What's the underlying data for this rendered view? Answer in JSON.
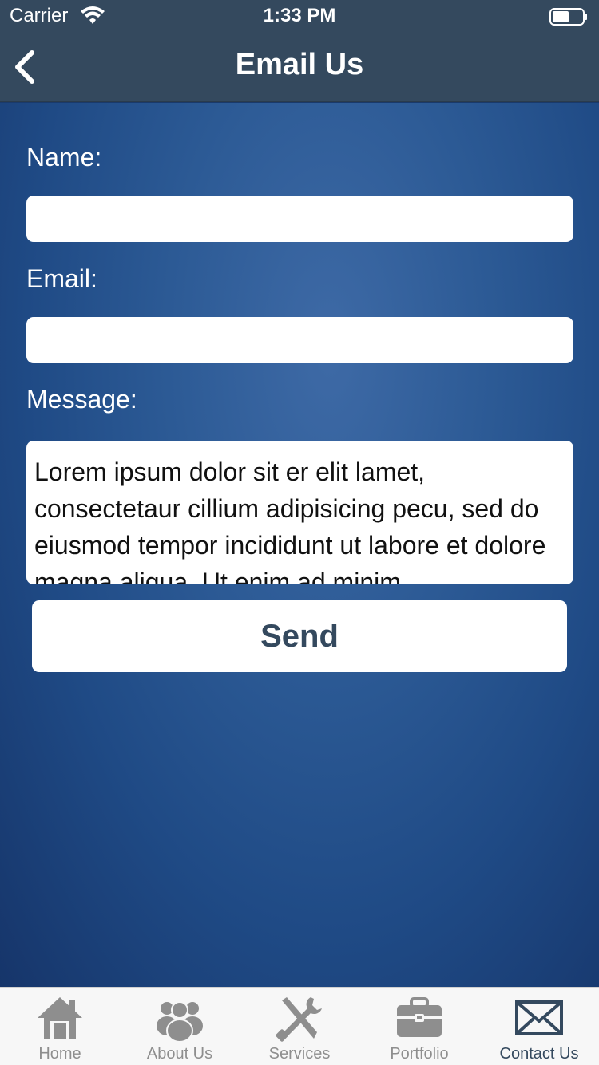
{
  "status_bar": {
    "carrier": "Carrier",
    "time": "1:33 PM",
    "wifi_icon": "wifi-icon",
    "battery_icon": "battery-icon"
  },
  "nav": {
    "title": "Email Us",
    "back_icon": "chevron-left-icon"
  },
  "form": {
    "name_label": "Name:",
    "name_value": "",
    "email_label": "Email:",
    "email_value": "",
    "message_label": "Message:",
    "message_value": "Lorem ipsum dolor sit er elit lamet, consectetaur cillium adipisicing pecu, sed do eiusmod tempor incididunt ut labore et dolore magna aliqua. Ut enim ad minim",
    "send_label": "Send"
  },
  "tabs": [
    {
      "label": "Home",
      "icon": "home-icon",
      "active": false
    },
    {
      "label": "About Us",
      "icon": "people-icon",
      "active": false
    },
    {
      "label": "Services",
      "icon": "tools-icon",
      "active": false
    },
    {
      "label": "Portfolio",
      "icon": "briefcase-icon",
      "active": false
    },
    {
      "label": "Contact Us",
      "icon": "envelope-icon",
      "active": true
    }
  ],
  "colors": {
    "nav_background": "#34495e",
    "content_gradient_center": "#3e6aa6",
    "content_gradient_edge": "#16356a",
    "tab_inactive": "#8e8e8e",
    "tab_active": "#34495e"
  }
}
